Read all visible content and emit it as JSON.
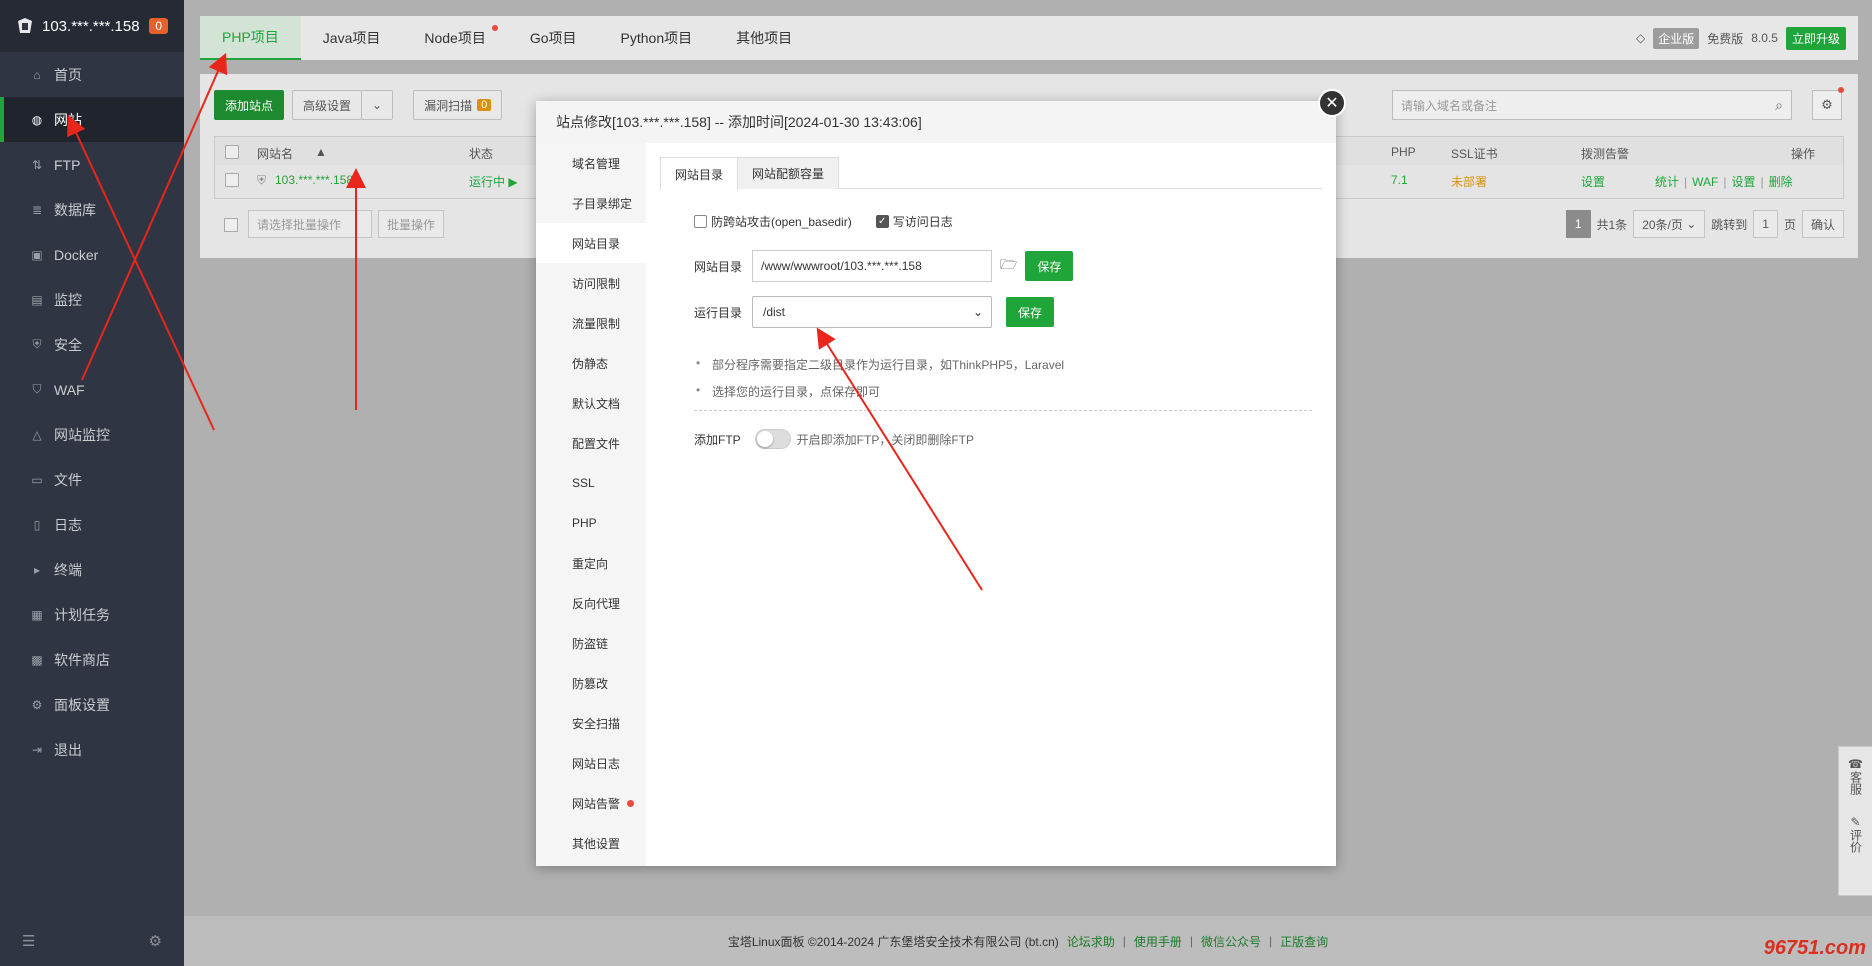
{
  "sidebar": {
    "server_ip": "103.***.***.158",
    "badge": "0",
    "items": [
      {
        "label": "首页",
        "icon": "home-icon"
      },
      {
        "label": "网站",
        "icon": "globe-icon",
        "active": true
      },
      {
        "label": "FTP",
        "icon": "ftp-icon"
      },
      {
        "label": "数据库",
        "icon": "database-icon"
      },
      {
        "label": "Docker",
        "icon": "docker-icon"
      },
      {
        "label": "监控",
        "icon": "monitor-icon"
      },
      {
        "label": "安全",
        "icon": "shield-icon"
      },
      {
        "label": "WAF",
        "icon": "waf-icon"
      },
      {
        "label": "网站监控",
        "icon": "site-monitor-icon"
      },
      {
        "label": "文件",
        "icon": "folder-icon"
      },
      {
        "label": "日志",
        "icon": "log-icon"
      },
      {
        "label": "终端",
        "icon": "terminal-icon"
      },
      {
        "label": "计划任务",
        "icon": "calendar-icon"
      },
      {
        "label": "软件商店",
        "icon": "store-icon"
      },
      {
        "label": "面板设置",
        "icon": "gear-icon"
      },
      {
        "label": "退出",
        "icon": "logout-icon"
      }
    ]
  },
  "top_tabs": [
    {
      "label": "PHP项目",
      "active": true
    },
    {
      "label": "Java项目"
    },
    {
      "label": "Node项目",
      "dot": true
    },
    {
      "label": "Go项目"
    },
    {
      "label": "Python项目"
    },
    {
      "label": "其他项目"
    }
  ],
  "top_right": {
    "enterprise": "企业版",
    "free": "免费版",
    "version": "8.0.5",
    "upgrade": "立即升级"
  },
  "toolbar": {
    "add_site": "添加站点",
    "advanced": "高级设置",
    "vuln_scan": "漏洞扫描",
    "vuln_count": "0",
    "search_placeholder": "请输入域名或备注"
  },
  "table": {
    "headers": {
      "name": "网站名",
      "status": "状态",
      "php": "PHP",
      "ssl": "SSL证书",
      "alert": "拨测告警",
      "ops": "操作"
    },
    "row": {
      "name": "103.***.***.158",
      "status": "运行中",
      "php": "7.1",
      "ssl": "未部署",
      "alert": "设置",
      "ops": [
        "统计",
        "WAF",
        "设置",
        "删除"
      ]
    }
  },
  "pager": {
    "batch_placeholder": "请选择批量操作",
    "batch_btn": "批量操作",
    "current": "1",
    "total": "共1条",
    "per_page": "20条/页",
    "jump_label": "跳转到",
    "jump_value": "1",
    "page_unit": "页",
    "confirm": "确认"
  },
  "modal": {
    "title": "站点修改[103.***.***.158] -- 添加时间[2024-01-30 13:43:06]",
    "nav": [
      {
        "label": "域名管理"
      },
      {
        "label": "子目录绑定"
      },
      {
        "label": "网站目录",
        "active": true
      },
      {
        "label": "访问限制"
      },
      {
        "label": "流量限制"
      },
      {
        "label": "伪静态"
      },
      {
        "label": "默认文档"
      },
      {
        "label": "配置文件"
      },
      {
        "label": "SSL"
      },
      {
        "label": "PHP"
      },
      {
        "label": "重定向"
      },
      {
        "label": "反向代理"
      },
      {
        "label": "防盗链"
      },
      {
        "label": "防篡改"
      },
      {
        "label": "安全扫描"
      },
      {
        "label": "网站日志"
      },
      {
        "label": "网站告警",
        "dot": true
      },
      {
        "label": "其他设置"
      }
    ],
    "tabs": [
      "网站目录",
      "网站配额容量"
    ],
    "checks": [
      {
        "label": "防跨站攻击(open_basedir)",
        "checked": false
      },
      {
        "label": "写访问日志",
        "checked": true
      }
    ],
    "site_dir_label": "网站目录",
    "site_dir_value": "/www/wwwroot/103.***.***.158",
    "run_dir_label": "运行目录",
    "run_dir_value": "/dist",
    "save": "保存",
    "tips": [
      "部分程序需要指定二级目录作为运行目录，如ThinkPHP5，Laravel",
      "选择您的运行目录，点保存即可"
    ],
    "ftp_label": "添加FTP",
    "ftp_desc": "开启即添加FTP，关闭即删除FTP",
    "ftp_enabled": false
  },
  "footer": {
    "copyright": "宝塔Linux面板 ©2014-2024 广东堡塔安全技术有限公司 (bt.cn)",
    "links": [
      "论坛求助",
      "使用手册",
      "微信公众号",
      "正版查询"
    ]
  },
  "side_float": [
    "客服",
    "评价"
  ],
  "watermark": "96751.com",
  "colors": {
    "accent": "#20a53a",
    "sidebar": "#2f3542",
    "annotation_arrows": "#e8261b"
  }
}
